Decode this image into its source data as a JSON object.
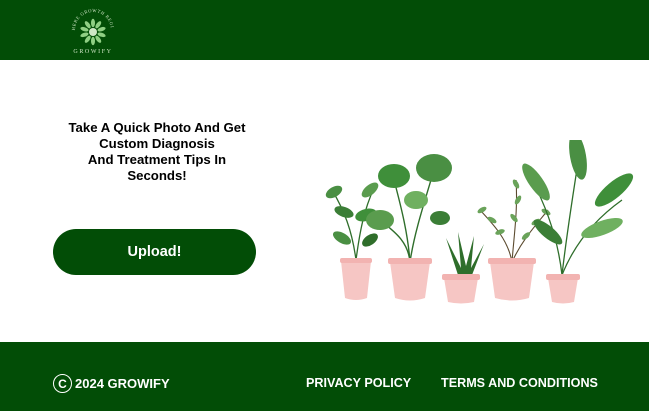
{
  "header": {
    "logo": {
      "tagline": "WHERE GROWTH BEGINS",
      "name": "GROWIFY",
      "icon": "leaf-wreath-icon"
    }
  },
  "hero": {
    "headline_lines": [
      "Take A Quick Photo And Get",
      "Custom Diagnosis",
      "And Treatment Tips In",
      "Seconds!"
    ],
    "upload_label": "Upload!",
    "illustration": "potted-plants-illustration"
  },
  "footer": {
    "copyright_symbol": "C",
    "copyright_text": "2024 GROWIFY",
    "links": [
      "PRIVACY POLICY",
      "TERMS AND CONDITIONS"
    ]
  },
  "colors": {
    "brand_green": "#024d06",
    "background": "#ffffff",
    "pot_pink": "#f6c6c4",
    "leaf_green": "#3f8f3a"
  }
}
